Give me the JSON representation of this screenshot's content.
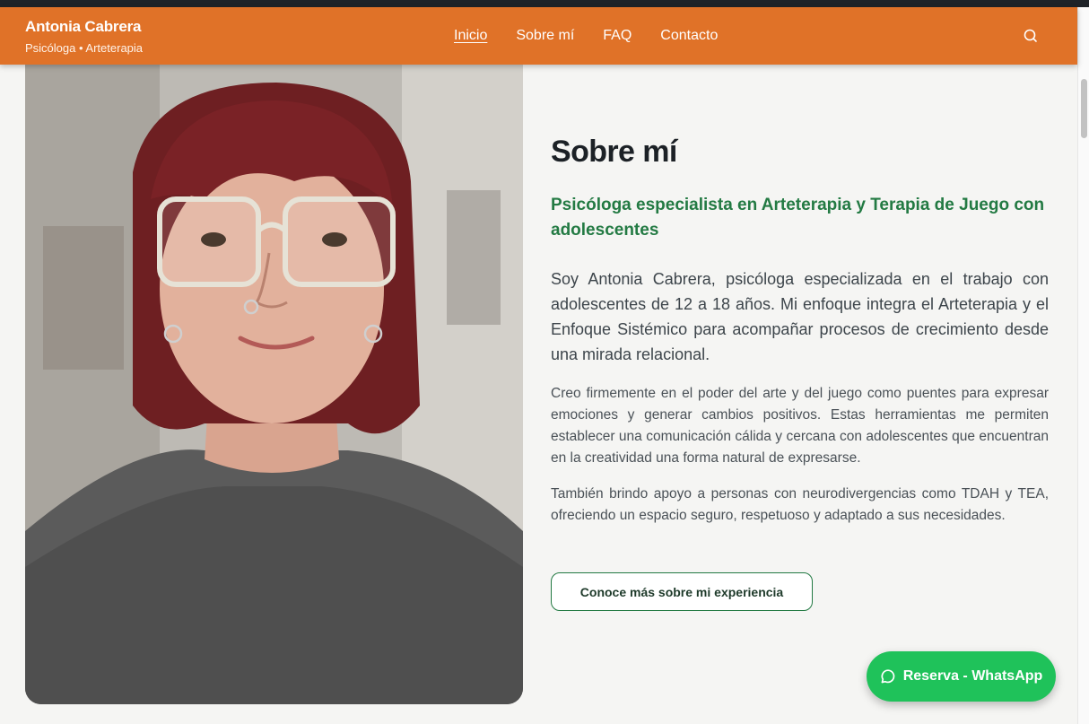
{
  "header": {
    "brand_name": "Antonia Cabrera",
    "brand_sub": "Psicóloga • Arteterapia",
    "nav": [
      "Inicio",
      "Sobre mí",
      "FAQ",
      "Contacto"
    ],
    "active_nav": "Inicio",
    "search_icon": "search-icon"
  },
  "about": {
    "title": "Sobre mí",
    "subtitle": "Psicóloga especialista en Arteterapia y Terapia de Juego con adolescentes",
    "lead": "Soy Antonia Cabrera, psicóloga especializada en el trabajo con adolescentes de 12 a 18 años. Mi enfoque integra el Arteterapia y el Enfoque Sistémico para acompañar procesos de crecimiento desde una mirada relacional.",
    "para1": "Creo firmemente en el poder del arte y del juego como puentes para expresar emociones y generar cambios positivos. Estas herramientas me permiten establecer una comunicación cálida y cercana con adolescentes que encuentran en la creatividad una forma natural de expresarse.",
    "para2": "También brindo apoyo a personas con neurodivergencias como TDAH y TEA, ofreciendo un espacio seguro, respetuoso y adaptado a sus necesidades.",
    "cta_label": "Conoce más sobre mi experiencia"
  },
  "whatsapp": {
    "label": "Reserva - WhatsApp",
    "icon": "chat-bubble-icon"
  },
  "colors": {
    "header": "#e07228",
    "accent_green": "#237a43",
    "whatsapp_green": "#1fc25a"
  }
}
